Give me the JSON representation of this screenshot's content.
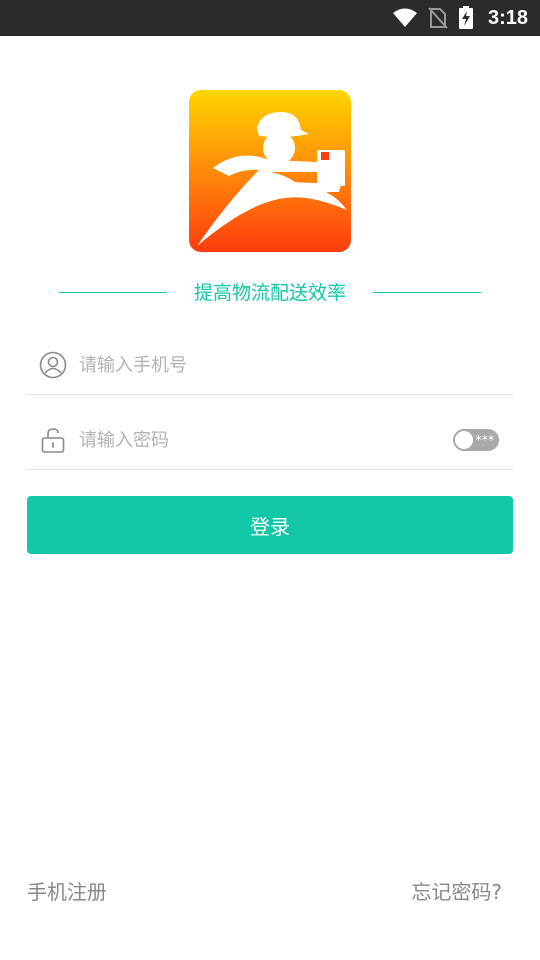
{
  "status_bar": {
    "time": "3:18",
    "icons": [
      "wifi-icon",
      "no-sim-icon",
      "battery-charging-icon"
    ]
  },
  "logo": {
    "icon": "courier-runner-logo-icon",
    "gradient_top": "#ffd500",
    "gradient_bottom": "#ff3d0e"
  },
  "slogan": "提高物流配送效率",
  "login_form": {
    "phone": {
      "icon": "user-icon",
      "placeholder": "请输入手机号",
      "value": ""
    },
    "password": {
      "icon": "unlock-icon",
      "placeholder": "请输入密码",
      "value": "",
      "toggle_mask": "***"
    },
    "login_label": "登录"
  },
  "footer": {
    "register_label": "手机注册",
    "forgot_label": "忘记密码?"
  },
  "colors": {
    "accent": "#12c6a8",
    "status_bar": "#2b2b2b",
    "placeholder": "#b2b2b2",
    "link": "#888888"
  }
}
